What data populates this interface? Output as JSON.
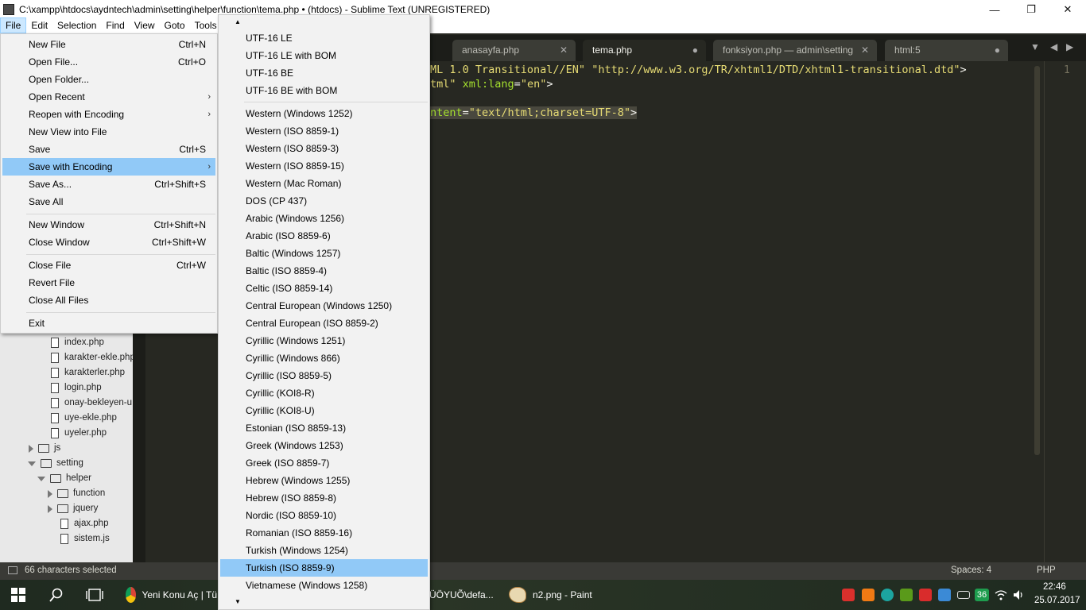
{
  "window": {
    "title": "C:\\xampp\\htdocs\\aydntech\\admin\\setting\\helper\\function\\tema.php • (htdocs) - Sublime Text (UNREGISTERED)",
    "minimize": "—",
    "maximize": "❐",
    "close": "✕"
  },
  "menubar": [
    "File",
    "Edit",
    "Selection",
    "Find",
    "View",
    "Goto",
    "Tools"
  ],
  "tabs": [
    {
      "label": "anasayfa.php",
      "marker": "✕"
    },
    {
      "label": "tema.php",
      "marker": "●"
    },
    {
      "label": "fonksiyon.php — admin\\setting",
      "marker": "✕"
    },
    {
      "label": "html:5",
      "marker": "●"
    }
  ],
  "tabnav": {
    "dropdown": "▼",
    "prev": "◀",
    "next": "▶"
  },
  "editor": {
    "line1": [
      "ML 1.0 Transitional//EN\" \"http://www.w3.org/TR/xhtml1/DTD/xhtml1-transitional.dtd\"",
      ">"
    ],
    "line2": [
      "tml\" ",
      "xml:lang",
      "=",
      "\"en\"",
      ">"
    ],
    "line3": [
      "ntent",
      "=",
      "\"text/html;charset=UTF-8\"",
      ">"
    ],
    "minimap_line": "1"
  },
  "file_menu": {
    "items": [
      {
        "label": "New File",
        "shortcut": "Ctrl+N"
      },
      {
        "label": "Open File...",
        "shortcut": "Ctrl+O"
      },
      {
        "label": "Open Folder...",
        "shortcut": ""
      },
      {
        "label": "Open Recent",
        "shortcut": "",
        "submenu": "›"
      },
      {
        "label": "Reopen with Encoding",
        "shortcut": "",
        "submenu": "›"
      },
      {
        "label": "New View into File",
        "shortcut": ""
      },
      {
        "label": "Save",
        "shortcut": "Ctrl+S"
      },
      {
        "label": "Save with Encoding",
        "shortcut": "",
        "submenu": "›"
      },
      {
        "label": "Save As...",
        "shortcut": "Ctrl+Shift+S"
      },
      {
        "label": "Save All",
        "shortcut": ""
      },
      {
        "label": "New Window",
        "shortcut": "Ctrl+Shift+N"
      },
      {
        "label": "Close Window",
        "shortcut": "Ctrl+Shift+W"
      },
      {
        "label": "Close File",
        "shortcut": "Ctrl+W"
      },
      {
        "label": "Revert File",
        "shortcut": ""
      },
      {
        "label": "Close All Files",
        "shortcut": ""
      },
      {
        "label": "Exit",
        "shortcut": ""
      }
    ]
  },
  "encoding_menu": {
    "scroll_up": "▲",
    "scroll_down": "▼",
    "items": [
      "UTF-16 LE",
      "UTF-16 LE with BOM",
      "UTF-16 BE",
      "UTF-16 BE with BOM",
      "Western (Windows 1252)",
      "Western (ISO 8859-1)",
      "Western (ISO 8859-3)",
      "Western (ISO 8859-15)",
      "Western (Mac Roman)",
      "DOS (CP 437)",
      "Arabic (Windows 1256)",
      "Arabic (ISO 8859-6)",
      "Baltic (Windows 1257)",
      "Baltic (ISO 8859-4)",
      "Celtic (ISO 8859-14)",
      "Central European (Windows 1250)",
      "Central European (ISO 8859-2)",
      "Cyrillic (Windows 1251)",
      "Cyrillic (Windows 866)",
      "Cyrillic (ISO 8859-5)",
      "Cyrillic (KOI8-R)",
      "Cyrillic (KOI8-U)",
      "Estonian (ISO 8859-13)",
      "Greek (Windows 1253)",
      "Greek (ISO 8859-7)",
      "Hebrew (Windows 1255)",
      "Hebrew (ISO 8859-8)",
      "Nordic (ISO 8859-10)",
      "Romanian (ISO 8859-16)",
      "Turkish (Windows 1254)",
      "Turkish (ISO 8859-9)",
      "Vietnamese (Windows 1258)"
    ],
    "selected": "Turkish (ISO 8859-9)"
  },
  "sidebar": {
    "files": [
      "index.php",
      "karakter-ekle.php",
      "karakterler.php",
      "login.php",
      "onay-bekleyen-u",
      "uye-ekle.php",
      "uyeler.php"
    ],
    "folders": {
      "js": "js",
      "setting": "setting",
      "helper": "helper",
      "function": "function",
      "jquery": "jquery"
    },
    "helper_files": [
      "ajax.php",
      "sistem.js"
    ]
  },
  "statusbar": {
    "selection": "66 characters selected",
    "spaces": "Spaces: 4",
    "syntax": "PHP"
  },
  "taskbar": {
    "chrome_label": "Yeni Konu Aç | Tü",
    "explorer_label": "ÜÖYUÕ\\defa...",
    "paint_label": "n2.png - Paint",
    "tray_badge": "36",
    "time": "22:46",
    "date": "25.07.2017"
  }
}
